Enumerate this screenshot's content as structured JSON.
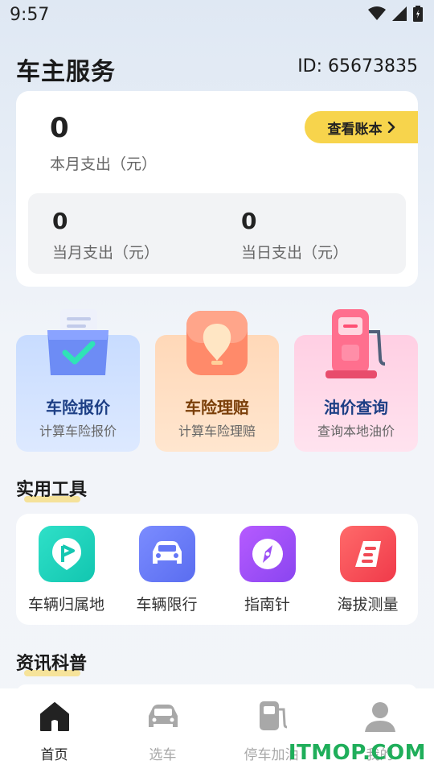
{
  "status_bar": {
    "time": "9:57"
  },
  "header": {
    "title": "车主服务",
    "id_text": "ID: 65673835"
  },
  "summary": {
    "month_total_value": "0",
    "month_total_label": "本月支出（元）",
    "ledger_button": "查看账本",
    "current_month_value": "0",
    "current_month_label": "当月支出（元）",
    "today_value": "0",
    "today_label": "当日支出（元）"
  },
  "services": [
    {
      "title": "车险报价",
      "subtitle": "计算车险报价",
      "icon": "insurance-quote-icon",
      "color": "#1d3f85"
    },
    {
      "title": "车险理赔",
      "subtitle": "计算车险理赔",
      "icon": "insurance-claim-icon",
      "color": "#7a3e08"
    },
    {
      "title": "油价查询",
      "subtitle": "查询本地油价",
      "icon": "fuel-pump-icon",
      "color": "#1d3f85"
    }
  ],
  "tools_section": {
    "title": "实用工具"
  },
  "tools": [
    {
      "label": "车辆归属地",
      "icon": "location-flag-icon"
    },
    {
      "label": "车辆限行",
      "icon": "car-icon"
    },
    {
      "label": "指南针",
      "icon": "compass-icon"
    },
    {
      "label": "海拔测量",
      "icon": "altitude-icon"
    }
  ],
  "news_section": {
    "title": "资讯科普"
  },
  "tab_bar": {
    "tabs": [
      {
        "label": "首页",
        "icon": "home-icon",
        "active": true
      },
      {
        "label": "选车",
        "icon": "car-tab-icon",
        "active": false
      },
      {
        "label": "停车加油",
        "icon": "gas-station-icon",
        "active": false
      },
      {
        "label": "我的",
        "icon": "profile-icon",
        "active": false
      }
    ]
  },
  "watermark": "ITMOP.COM",
  "colors": {
    "accent_yellow": "#f7d44c",
    "tab_active": "#222222",
    "tab_inactive": "#a8a8a8",
    "watermark": "#1fae5a"
  }
}
